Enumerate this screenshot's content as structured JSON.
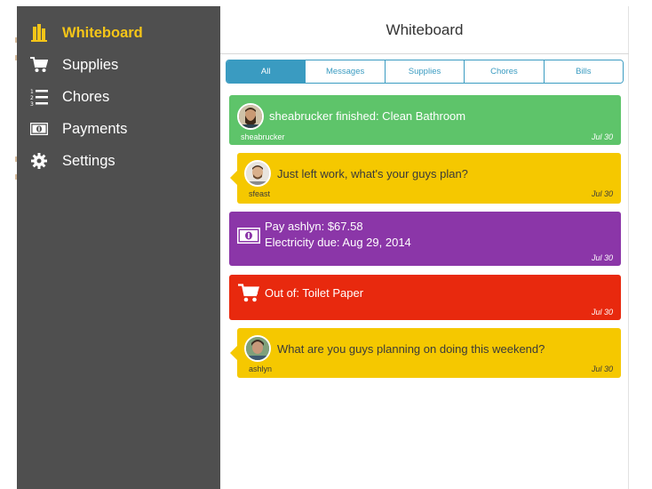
{
  "colors": {
    "sidebar_bg": "#4f4f4f",
    "active_accent": "#f5c518",
    "tab_accent": "#3a9bc1",
    "chore_done": "#5ec46a",
    "message": "#f5c800",
    "bill": "#8b36a8",
    "supply": "#e8290e"
  },
  "sidebar": {
    "items": [
      {
        "label": "Whiteboard",
        "icon": "building-icon",
        "active": true
      },
      {
        "label": "Supplies",
        "icon": "cart-icon",
        "active": false
      },
      {
        "label": "Chores",
        "icon": "list-icon",
        "active": false
      },
      {
        "label": "Payments",
        "icon": "money-icon",
        "active": false
      },
      {
        "label": "Settings",
        "icon": "gear-icon",
        "active": false
      }
    ]
  },
  "header": {
    "title": "Whiteboard"
  },
  "tabs": [
    {
      "label": "All",
      "active": true
    },
    {
      "label": "Messages",
      "active": false
    },
    {
      "label": "Supplies",
      "active": false
    },
    {
      "label": "Chores",
      "active": false
    },
    {
      "label": "Bills",
      "active": false
    }
  ],
  "feed": [
    {
      "type": "chore",
      "message": "sheabrucker finished: Clean Bathroom",
      "user": "sheabrucker",
      "date": "Jul 30"
    },
    {
      "type": "message",
      "message": "Just left work, what's your guys plan?",
      "user": "sfeast",
      "date": "Jul 30"
    },
    {
      "type": "bill",
      "line1": "Pay ashlyn: $67.58",
      "line2": "Electricity due: Aug 29, 2014",
      "date": "Jul 30"
    },
    {
      "type": "supply",
      "message": "Out of: Toilet Paper",
      "date": "Jul 30"
    },
    {
      "type": "message",
      "message": "What are you guys planning on doing this weekend?",
      "user": "ashlyn",
      "date": "Jul 30"
    }
  ]
}
